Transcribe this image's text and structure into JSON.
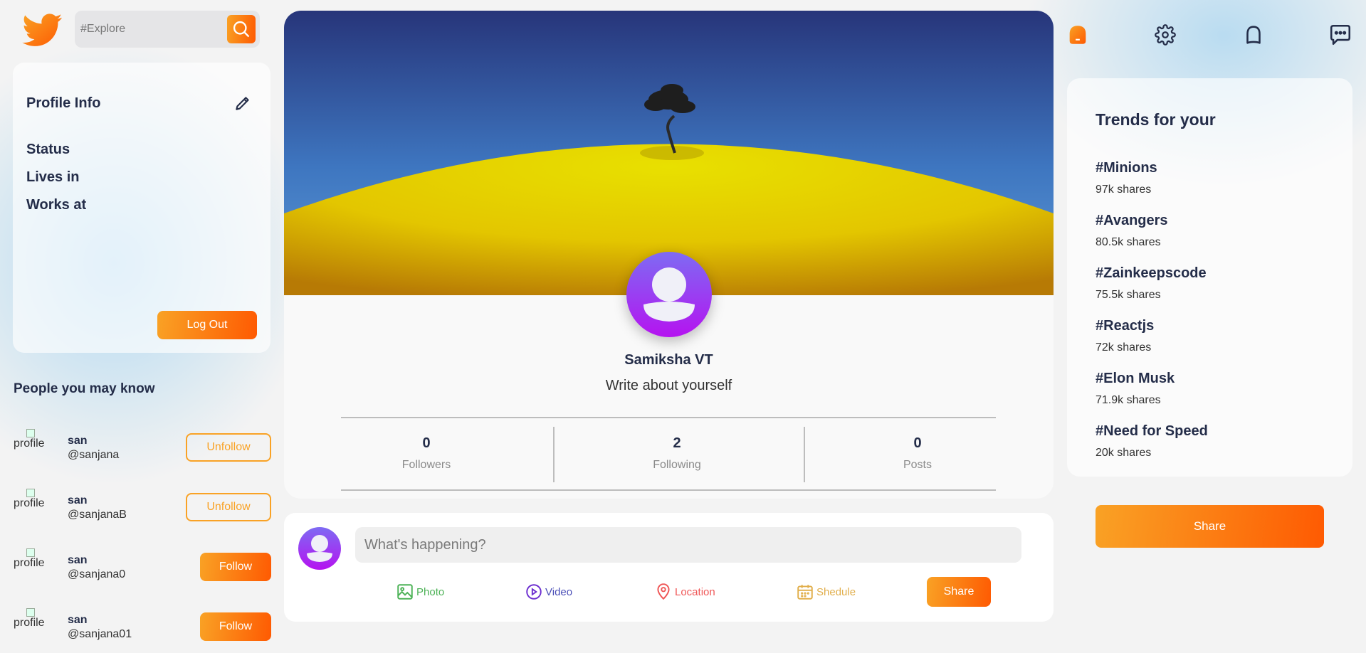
{
  "search": {
    "placeholder": "#Explore"
  },
  "profile_info": {
    "title": "Profile Info",
    "rows": [
      "Status",
      "Lives in",
      "Works at"
    ],
    "logout_label": "Log Out"
  },
  "people": {
    "title": "People you may know",
    "img_alt": "profile",
    "items": [
      {
        "name": "san",
        "handle": "@sanjana",
        "action": "Unfollow"
      },
      {
        "name": "san",
        "handle": "@sanjanaB",
        "action": "Unfollow"
      },
      {
        "name": "san",
        "handle": "@sanjana0",
        "action": "Follow"
      },
      {
        "name": "san",
        "handle": "@sanjana01",
        "action": "Follow"
      }
    ]
  },
  "profile": {
    "name": "Samiksha VT",
    "bio": "Write about yourself",
    "stats": [
      {
        "value": "0",
        "label": "Followers"
      },
      {
        "value": "2",
        "label": "Following"
      },
      {
        "value": "0",
        "label": "Posts"
      }
    ]
  },
  "post_share": {
    "placeholder": "What's happening?",
    "options": [
      {
        "label": "Photo",
        "color": "#4cb256",
        "icon": "photo-icon"
      },
      {
        "label": "Video",
        "color": "#4a4eb7",
        "icon": "play-circle-icon"
      },
      {
        "label": "Location",
        "color": "#ef5757",
        "icon": "location-pin-icon"
      },
      {
        "label": "Shedule",
        "color": "#e1ae4a",
        "icon": "calendar-icon"
      }
    ],
    "share_label": "Share"
  },
  "trends": {
    "title": "Trends for your",
    "items": [
      {
        "tag": "#Minions",
        "shares": "97k shares"
      },
      {
        "tag": "#Avangers",
        "shares": "80.5k shares"
      },
      {
        "tag": "#Zainkeepscode",
        "shares": "75.5k shares"
      },
      {
        "tag": "#Reactjs",
        "shares": "72k shares"
      },
      {
        "tag": "#Elon Musk",
        "shares": "71.9k shares"
      },
      {
        "tag": "#Need for Speed",
        "shares": "20k shares"
      }
    ]
  },
  "share_button_label": "Share",
  "colors": {
    "accent_orange": "#f9a225",
    "accent_orange_dark": "#fe5a02",
    "text_dark": "#242d49",
    "avatar_purple": "#8e2de2"
  }
}
